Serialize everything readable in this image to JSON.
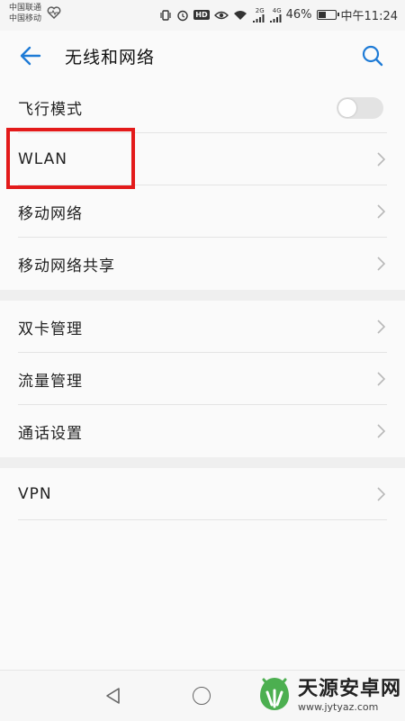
{
  "status_bar": {
    "carrier_1": "中国联通",
    "carrier_2": "中国移动",
    "hd": "HD",
    "net_2g": "2G",
    "net_4g": "4G",
    "battery_percent": "46%",
    "battery_level": 0.46,
    "time": "中午11:24"
  },
  "header": {
    "title": "无线和网络"
  },
  "section_1": {
    "airplane_mode": {
      "label": "飞行模式",
      "enabled": false
    },
    "wlan": {
      "label": "WLAN"
    },
    "mobile_network": {
      "label": "移动网络"
    },
    "mobile_network_sharing": {
      "label": "移动网络共享"
    }
  },
  "section_2": {
    "dual_sim": {
      "label": "双卡管理"
    },
    "data_usage": {
      "label": "流量管理"
    },
    "call_settings": {
      "label": "通话设置"
    }
  },
  "section_3": {
    "vpn": {
      "label": "VPN"
    }
  },
  "watermark": {
    "name": "天源安卓网",
    "url": "www.jytyaz.com"
  },
  "colors": {
    "accent": "#1e7bd6",
    "highlight": "#e31a1a",
    "watermark_green": "#4caf50"
  }
}
